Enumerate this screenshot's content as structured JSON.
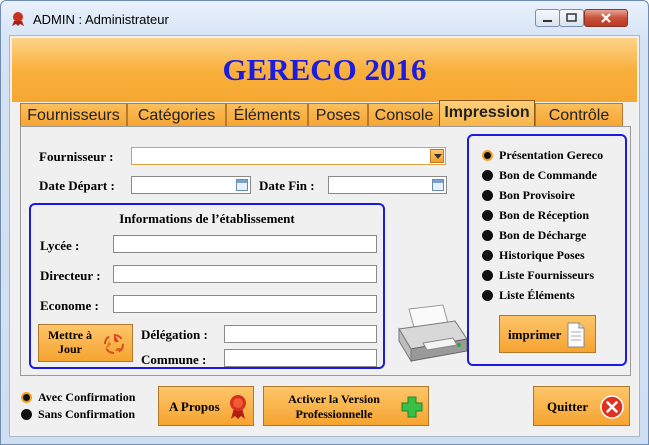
{
  "window": {
    "title": "ADMIN : Administrateur"
  },
  "banner": {
    "title": "GERECO 2016"
  },
  "tabs": [
    {
      "label": "Fournisseurs"
    },
    {
      "label": "Catégories"
    },
    {
      "label": "Éléments"
    },
    {
      "label": "Poses"
    },
    {
      "label": "Console"
    },
    {
      "label": "Impression",
      "active": true
    },
    {
      "label": "Contrôle"
    }
  ],
  "form": {
    "fournisseur_label": "Fournisseur :",
    "fournisseur_value": "",
    "date_depart_label": "Date Départ :",
    "date_depart_value": "",
    "date_fin_label": "Date Fin :",
    "date_fin_value": ""
  },
  "etablissement": {
    "title": "Informations de l’établissement",
    "lycee_label": "Lycée :",
    "lycee_value": "",
    "directeur_label": "Directeur :",
    "directeur_value": "",
    "econome_label": "Econome :",
    "econome_value": "",
    "delegation_label": "Délégation :",
    "delegation_value": "",
    "commune_label": "Commune :",
    "commune_value": "",
    "update_button": "Mettre à Jour"
  },
  "reports": {
    "options": [
      {
        "label": "Présentation Gereco",
        "selected": true
      },
      {
        "label": "Bon de Commande"
      },
      {
        "label": "Bon Provisoire"
      },
      {
        "label": "Bon de Réception"
      },
      {
        "label": "Bon de Décharge"
      },
      {
        "label": "Historique Poses"
      },
      {
        "label": "Liste Fournisseurs"
      },
      {
        "label": "Liste Éléments"
      }
    ],
    "print_button": "imprimer"
  },
  "confirmation": {
    "options": [
      {
        "label": "Avec Confirmation",
        "selected": true
      },
      {
        "label": "Sans Confirmation"
      }
    ]
  },
  "footer": {
    "about_button": "A Propos",
    "activate_button": "Activer la Version Professionnelle",
    "quit_button": "Quitter"
  },
  "colors": {
    "accent": "#f6a730",
    "group_border": "#1a1ae0",
    "title_blue": "#1c1ce0"
  }
}
